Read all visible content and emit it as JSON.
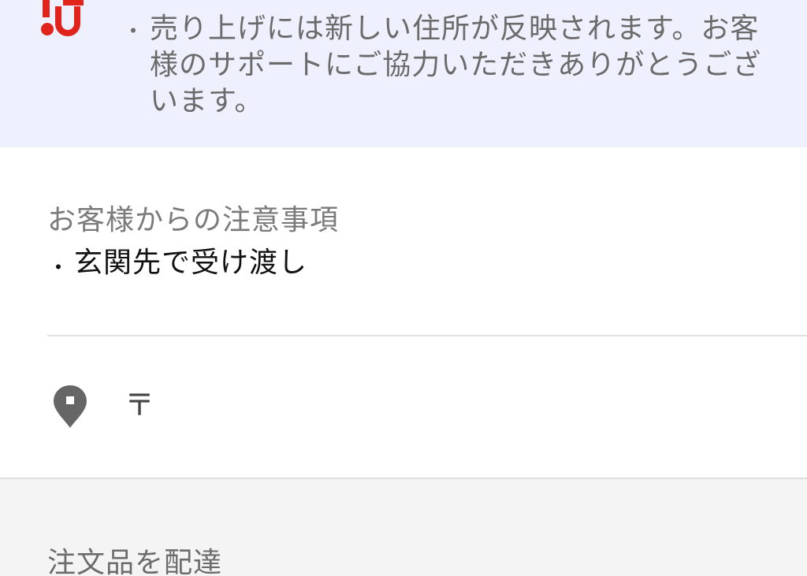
{
  "notice": {
    "bullet": "・",
    "text": "売り上げには新しい住所が反映されます。お客様のサポートにご協力いただきありがとうございます。",
    "logo_color": "#e0241b"
  },
  "customer_notes": {
    "heading": "お客様からの注意事項",
    "items": [
      {
        "bullet": "・",
        "text": "玄関先で受け渡し"
      }
    ]
  },
  "address": {
    "icon": "location-pin-icon",
    "postal_mark": "〒"
  },
  "order_section": {
    "heading": "注文品を配達"
  },
  "colors": {
    "banner_bg": "#eef0fd",
    "section_bg": "#f4f4f4",
    "pin": "#666666"
  }
}
